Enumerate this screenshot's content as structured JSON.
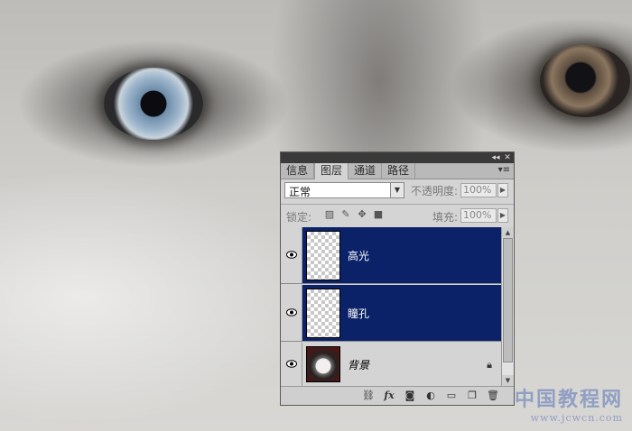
{
  "panel": {
    "tabs": [
      {
        "label": "信息"
      },
      {
        "label": "图层",
        "active": true
      },
      {
        "label": "通道"
      },
      {
        "label": "路径"
      }
    ],
    "blend_mode": "正常",
    "opacity_label": "不透明度:",
    "opacity_value": "100%",
    "lock_label": "锁定:",
    "fill_label": "填充:",
    "fill_value": "100%",
    "layers": [
      {
        "name": "高光",
        "selected": true,
        "visible": true
      },
      {
        "name": "瞳孔",
        "selected": true,
        "visible": true
      },
      {
        "name": "背景",
        "selected": false,
        "visible": true,
        "locked": true
      }
    ],
    "icons": {
      "link": "link-icon",
      "fx": "fx",
      "mask": "mask-icon",
      "adjustment": "adjustment-icon",
      "group": "folder-icon",
      "new_layer": "new-layer-icon",
      "delete": "trash-icon"
    },
    "colors": {
      "selection": "#0b2268"
    }
  },
  "watermark": {
    "text": "中国教程网",
    "url": "www.jcwcn.com"
  }
}
